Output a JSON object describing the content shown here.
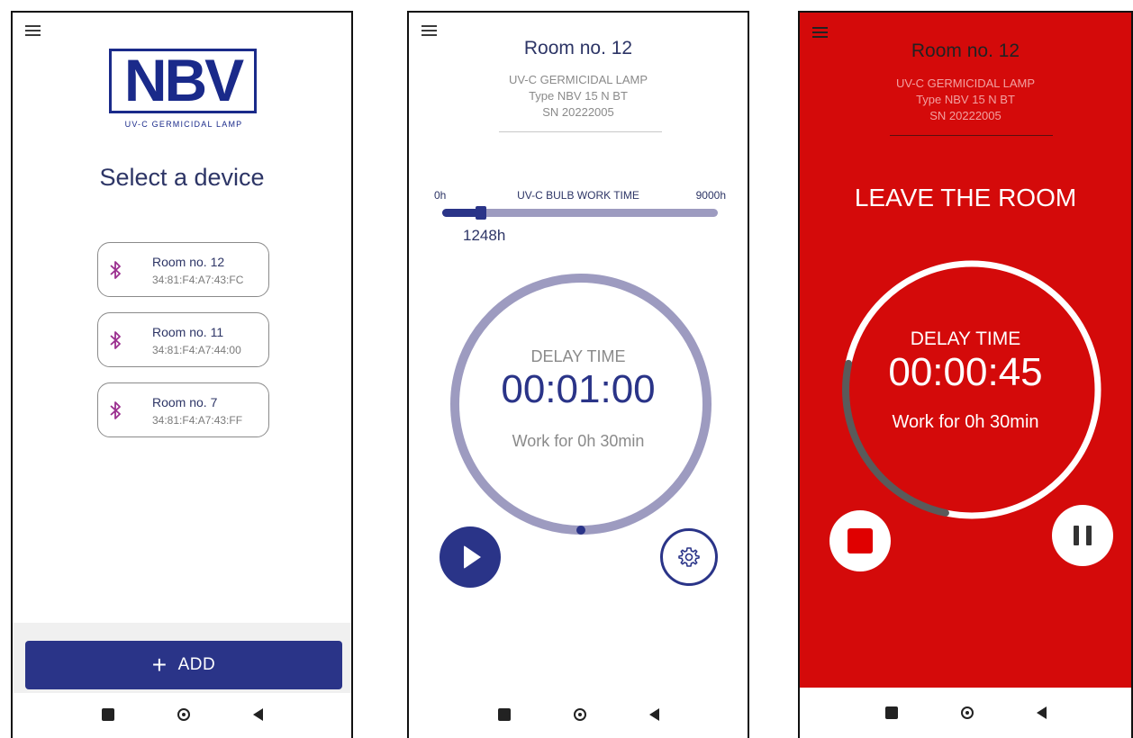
{
  "device_list": {
    "logo_text": "NBV",
    "logo_subtitle": "UV-C GERMICIDAL LAMP",
    "title": "Select a device",
    "devices": [
      {
        "name": "Room no. 12",
        "mac": "34:81:F4:A7:43:FC"
      },
      {
        "name": "Room no. 11",
        "mac": "34:81:F4:A7:44:00"
      },
      {
        "name": "Room no. 7",
        "mac": "34:81:F4:A7:43:FF"
      }
    ],
    "add_label": "ADD",
    "add_icon": "+"
  },
  "device_idle": {
    "room": "Room no. 12",
    "lamp_title": "UV-C GERMICIDAL LAMP",
    "lamp_type": "Type NBV 15 N BT",
    "lamp_sn": "SN 20222005",
    "bulb_min": "0h",
    "bulb_label": "UV-C BULB WORK TIME",
    "bulb_max": "9000h",
    "bulb_hours": "1248h",
    "bulb_progress": 0.139,
    "delay_label": "DELAY TIME",
    "delay_value": "00:01:00",
    "work_label": "Work for 0h 30min"
  },
  "device_running": {
    "room": "Room no. 12",
    "lamp_title": "UV-C GERMICIDAL LAMP",
    "lamp_type": "Type NBV 15 N BT",
    "lamp_sn": "SN 20222005",
    "warning": "LEAVE THE ROOM",
    "delay_label": "DELAY TIME",
    "delay_value": "00:00:45",
    "work_label": "Work for 0h 30min",
    "delay_progress": 0.25
  },
  "colors": {
    "primary": "#2a3488",
    "ring_idle": "#9d9bc0",
    "alarm_red": "#d40a0a",
    "bluetooth": "#9b2f8f"
  },
  "icons": [
    "menu-icon",
    "bluetooth-icon",
    "plus-icon",
    "play-icon",
    "gear-icon",
    "stop-icon",
    "pause-icon",
    "nav-recent-icon",
    "nav-home-icon",
    "nav-back-icon"
  ]
}
